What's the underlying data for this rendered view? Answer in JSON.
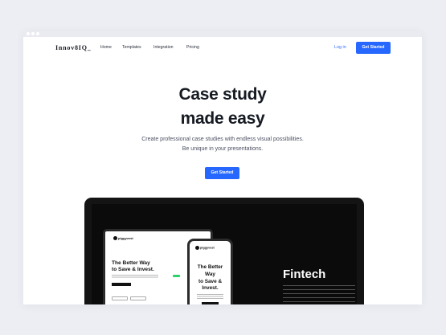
{
  "nav": {
    "logo": "Innov8IQ_",
    "links": [
      "Home",
      "Templates",
      "Integration",
      "Pricing"
    ],
    "login": "Log in",
    "cta": "Get Started"
  },
  "hero": {
    "title_line1": "Case study",
    "title_line2": "made easy",
    "subtitle_line1": "Create professional case studies with endless visual possibilities.",
    "subtitle_line2": "Be unique in your presentations.",
    "cta": "Get Started"
  },
  "preview": {
    "brand": "piggyvest",
    "desktop_headline_line1": "The Better Way",
    "desktop_headline_line2": "to Save & Invest.",
    "phone_headline_line1": "The Better",
    "phone_headline_line2": "Way",
    "phone_headline_line3": "to Save &",
    "phone_headline_line4": "Invest.",
    "category": "Fintech"
  },
  "colors": {
    "accent": "#2667ff",
    "page_bg": "#eceef3",
    "laptop": "#141414"
  }
}
